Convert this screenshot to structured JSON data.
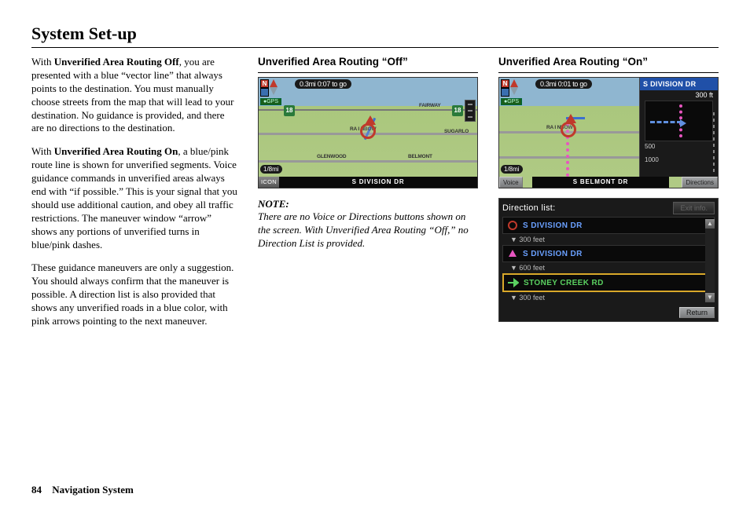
{
  "page_title": "System Set-up",
  "body": {
    "p1_prefix": "With ",
    "p1_bold": "Unverified Area Routing Off",
    "p1_rest": ", you are presented with a blue “vector line” that always points to the destination. You must manually choose streets from the map that will lead to your destination. No guidance is provided, and there are no directions to the destination.",
    "p2_prefix": "With ",
    "p2_bold": "Unverified Area Routing On",
    "p2_rest": ", a blue/pink route line is shown for unverified segments. Voice guidance commands in unverified areas always end with “if possible.” This is your signal that you should use additional caution, and obey all traffic restrictions. The maneuver window “arrow” shows any portions of unverified turns in blue/pink dashes.",
    "p3": "These guidance maneuvers are only a suggestion. You should always confirm that the maneuver is possible. A direction list is also provided that shows any unverified roads in a blue color, with pink arrows pointing to the next maneuver."
  },
  "off_section": {
    "heading": "Unverified Area Routing “Off”",
    "note_label": "NOTE:",
    "note_text": "There are no Voice or Directions buttons shown on the screen. With Unverified Area Routing “Off,” no Direction List is provided."
  },
  "on_section": {
    "heading": "Unverified Area Routing “On”"
  },
  "nav_off": {
    "top_status": "0.3mi 0:07 to go",
    "gps": "●GPS",
    "compass_n": "N",
    "scale": "1/8mi",
    "icon_btn": "ICON",
    "street_bar": "S DIVISION DR",
    "highway": "18",
    "labels": {
      "rainbow": "RA I NBOW",
      "fairway": "FAIRWAY",
      "sugar": "SUGARLO",
      "glen": "GLENWOOD",
      "belmont": "BELMONT"
    }
  },
  "nav_on": {
    "top_status": "0.3mi 0:01 to go",
    "gps": "●GPS",
    "compass_n": "N",
    "scale": "1/8mi",
    "voice_btn": "Voice",
    "dir_btn": "Directions",
    "street_bar": "S BELMONT DR",
    "side_street": "S DIVISION DR",
    "side_dist": "300 ft",
    "tick500": "500",
    "tick1000": "1000",
    "labels": {
      "rainbow": "RA I NBOW"
    }
  },
  "dir_list": {
    "title": "Direction list:",
    "exit": "Exit info.",
    "rows": [
      {
        "name": "S DIVISION DR",
        "distance": "300 feet",
        "type": "blue",
        "icon": "circle"
      },
      {
        "name": "S DIVISION DR",
        "distance": "600 feet",
        "type": "blue",
        "icon": "pink-up"
      },
      {
        "name": "STONEY CREEK RD",
        "distance": "300 feet",
        "type": "green",
        "icon": "green-right",
        "selected": true
      }
    ],
    "sub_prefix": "▼ ",
    "return": "Return",
    "up": "▲",
    "down": "▼"
  },
  "footer": {
    "page_num": "84",
    "label": "Navigation System"
  }
}
